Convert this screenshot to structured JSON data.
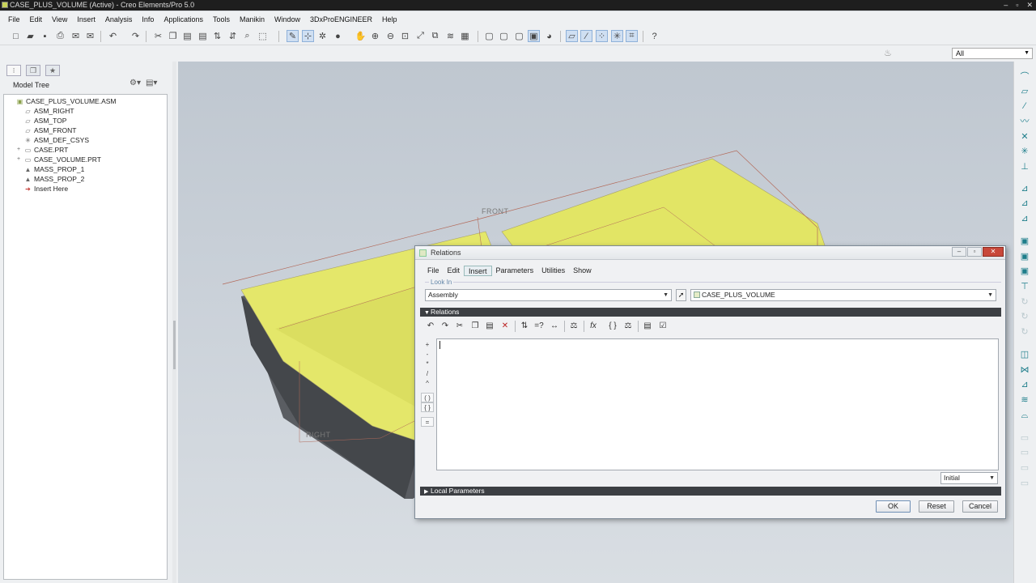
{
  "window": {
    "title": "CASE_PLUS_VOLUME (Active) - Creo Elements/Pro 5.0",
    "controls": [
      "–",
      "▫",
      "✕"
    ]
  },
  "menubar": [
    "File",
    "Edit",
    "View",
    "Insert",
    "Analysis",
    "Info",
    "Applications",
    "Tools",
    "Manikin",
    "Window",
    "3DxProENGINEER",
    "Help"
  ],
  "filter": {
    "value": "All"
  },
  "model_tree": {
    "header": "Model Tree",
    "items": [
      {
        "label": "CASE_PLUS_VOLUME.ASM",
        "icon": "assembly-icon",
        "glyph": "▣",
        "indent": 0,
        "expander": ""
      },
      {
        "label": "ASM_RIGHT",
        "icon": "datum-plane-icon",
        "glyph": "▱",
        "indent": 1,
        "expander": ""
      },
      {
        "label": "ASM_TOP",
        "icon": "datum-plane-icon",
        "glyph": "▱",
        "indent": 1,
        "expander": ""
      },
      {
        "label": "ASM_FRONT",
        "icon": "datum-plane-icon",
        "glyph": "▱",
        "indent": 1,
        "expander": ""
      },
      {
        "label": "ASM_DEF_CSYS",
        "icon": "csys-icon",
        "glyph": "✳",
        "indent": 1,
        "expander": ""
      },
      {
        "label": "CASE.PRT",
        "icon": "part-icon",
        "glyph": "▭",
        "indent": 1,
        "expander": "+"
      },
      {
        "label": "CASE_VOLUME.PRT",
        "icon": "part-icon",
        "glyph": "▭",
        "indent": 1,
        "expander": "+"
      },
      {
        "label": "MASS_PROP_1",
        "icon": "analysis-icon",
        "glyph": "▲",
        "indent": 1,
        "expander": ""
      },
      {
        "label": "MASS_PROP_2",
        "icon": "analysis-icon",
        "glyph": "▲",
        "indent": 1,
        "expander": ""
      },
      {
        "label": "Insert Here",
        "icon": "insert-here-arrow-icon",
        "glyph": "➔",
        "indent": 1,
        "expander": ""
      }
    ]
  },
  "viewport": {
    "plane_labels": [
      "FRONT",
      "RIGHT"
    ],
    "model_fill": "#e4e76a",
    "model_wall": "#5f6266"
  },
  "dialog": {
    "title": "Relations",
    "menu": [
      "File",
      "Edit",
      "Insert",
      "Parameters",
      "Utilities",
      "Show"
    ],
    "look_in_label": "Look In",
    "look_in_type": "Assembly",
    "look_in_model": "CASE_PLUS_VOLUME",
    "relations_section": "Relations",
    "relations_text": "",
    "sort_option": "Initial",
    "local_params_section": "Local Parameters",
    "buttons": {
      "ok": "OK",
      "reset": "Reset",
      "cancel": "Cancel"
    },
    "operators": [
      "+",
      "-",
      "*",
      "/",
      "^",
      "( )",
      "{ }",
      "="
    ]
  }
}
